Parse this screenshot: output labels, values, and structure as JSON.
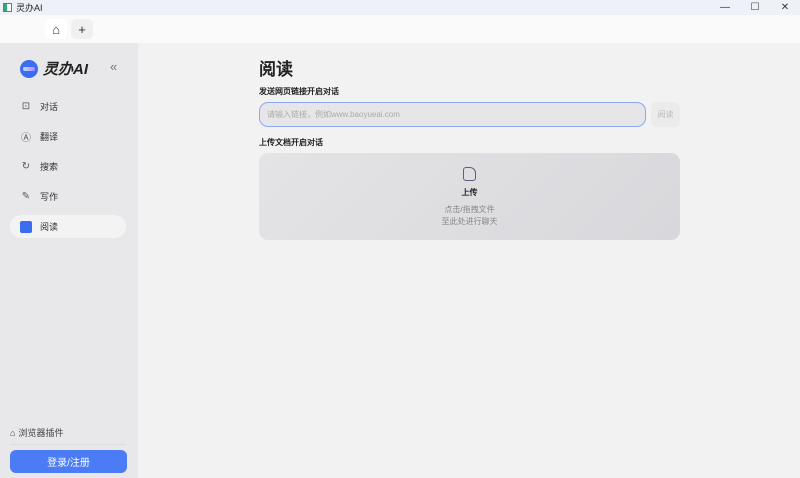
{
  "window": {
    "title": "灵办AI"
  },
  "tabs": {
    "new_tab": "+"
  },
  "sidebar": {
    "brand": "灵办AI",
    "collapse": "«",
    "items": [
      {
        "label": "对话"
      },
      {
        "label": "翻译"
      },
      {
        "label": "搜索"
      },
      {
        "label": "写作"
      },
      {
        "label": "阅读"
      }
    ],
    "plugin": "浏览器插件",
    "login": "登录/注册"
  },
  "main": {
    "title": "阅读",
    "url_label": "发送网页链接开启对话",
    "url_placeholder": "请输入链接，例如www.baoyueai.com",
    "read_button": "阅读",
    "upload_label": "上传文档开启对话",
    "upload_title": "上传",
    "upload_hint1": "点击/拖拽文件",
    "upload_hint2": "至此处进行聊天"
  },
  "colors": {
    "accent": "#4b7bf5"
  }
}
